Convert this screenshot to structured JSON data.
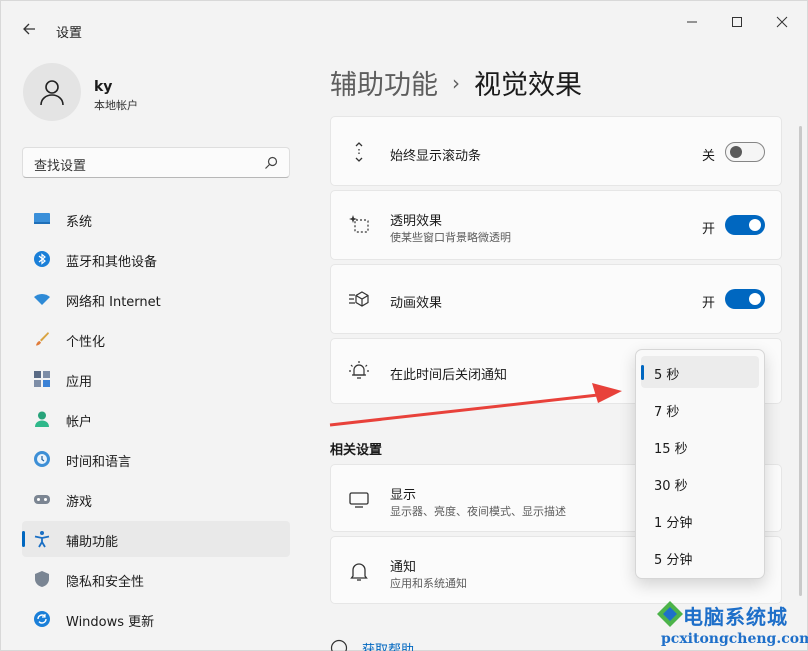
{
  "window": {
    "title": "设置",
    "controls": [
      "minimize",
      "maximize",
      "close"
    ]
  },
  "user": {
    "name": "ky",
    "account_type": "本地帐户"
  },
  "search": {
    "placeholder": "查找设置"
  },
  "sidebar": {
    "items": [
      {
        "label": "系统",
        "icon": "system-icon",
        "active": false
      },
      {
        "label": "蓝牙和其他设备",
        "icon": "bluetooth-icon",
        "active": false
      },
      {
        "label": "网络和 Internet",
        "icon": "wifi-icon",
        "active": false
      },
      {
        "label": "个性化",
        "icon": "brush-icon",
        "active": false
      },
      {
        "label": "应用",
        "icon": "apps-icon",
        "active": false
      },
      {
        "label": "帐户",
        "icon": "account-icon",
        "active": false
      },
      {
        "label": "时间和语言",
        "icon": "time-language-icon",
        "active": false
      },
      {
        "label": "游戏",
        "icon": "gamepad-icon",
        "active": false
      },
      {
        "label": "辅助功能",
        "icon": "accessibility-icon",
        "active": true
      },
      {
        "label": "隐私和安全性",
        "icon": "shield-icon",
        "active": false
      },
      {
        "label": "Windows 更新",
        "icon": "update-icon",
        "active": false
      }
    ]
  },
  "breadcrumb": {
    "parent": "辅助功能",
    "separator": "›",
    "current": "视觉效果"
  },
  "settings": [
    {
      "title": "始终显示滚动条",
      "subtitle": "",
      "toggle_label": "关",
      "toggle_on": false,
      "icon": "scrollbar-icon"
    },
    {
      "title": "透明效果",
      "subtitle": "使某些窗口背景略微透明",
      "toggle_label": "开",
      "toggle_on": true,
      "icon": "transparency-icon"
    },
    {
      "title": "动画效果",
      "subtitle": "",
      "toggle_label": "开",
      "toggle_on": true,
      "icon": "animation-icon"
    },
    {
      "title": "在此时间后关闭通知",
      "subtitle": "",
      "icon": "notification-timer-icon"
    }
  ],
  "related": {
    "heading": "相关设置",
    "items": [
      {
        "title": "显示",
        "subtitle": "显示器、亮度、夜间模式、显示描述",
        "icon": "display-icon"
      },
      {
        "title": "通知",
        "subtitle": "应用和系统通知",
        "icon": "bell-icon"
      }
    ]
  },
  "help_link": "获取帮助",
  "dropdown": {
    "options": [
      "5 秒",
      "7 秒",
      "15 秒",
      "30 秒",
      "1 分钟",
      "5 分钟"
    ],
    "selected_index": 0
  },
  "watermark": {
    "title": "电脑系统城",
    "url": "pcxitongcheng.com"
  },
  "colors": {
    "accent": "#0067c0",
    "annotation_arrow": "#e8413a",
    "watermark": "#1e6fc9"
  }
}
